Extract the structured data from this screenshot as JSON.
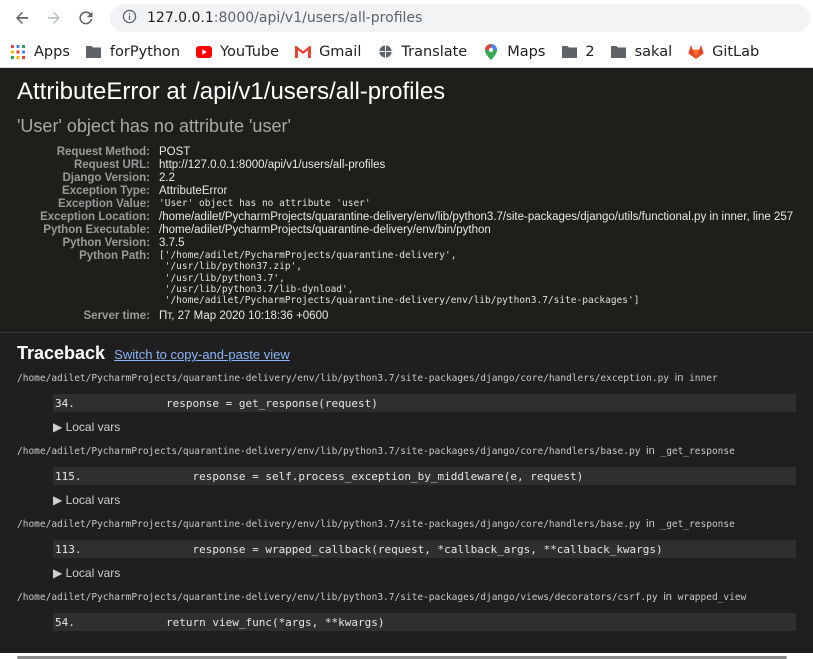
{
  "browser": {
    "url_host": "127.0.0.1",
    "url_path": ":8000/api/v1/users/all-profiles",
    "bookmarks": [
      {
        "label": "Apps",
        "icon": "apps-grid-icon"
      },
      {
        "label": "forPython",
        "icon": "folder-icon"
      },
      {
        "label": "YouTube",
        "icon": "youtube-icon"
      },
      {
        "label": "Gmail",
        "icon": "gmail-icon"
      },
      {
        "label": "Translate",
        "icon": "translate-icon"
      },
      {
        "label": "Maps",
        "icon": "maps-icon"
      },
      {
        "label": "2",
        "icon": "folder-icon"
      },
      {
        "label": "sakal",
        "icon": "folder-icon"
      },
      {
        "label": "GitLab",
        "icon": "gitlab-icon"
      }
    ]
  },
  "error": {
    "title": "AttributeError at /api/v1/users/all-profiles",
    "message": "'User' object has no attribute 'user'",
    "meta": [
      {
        "label": "Request Method:",
        "value": "POST",
        "mono": false
      },
      {
        "label": "Request URL:",
        "value": "http://127.0.0.1:8000/api/v1/users/all-profiles",
        "mono": false
      },
      {
        "label": "Django Version:",
        "value": "2.2",
        "mono": false
      },
      {
        "label": "Exception Type:",
        "value": "AttributeError",
        "mono": false
      },
      {
        "label": "Exception Value:",
        "value": "'User' object has no attribute 'user'",
        "mono": true
      },
      {
        "label": "Exception Location:",
        "value": "/home/adilet/PycharmProjects/quarantine-delivery/env/lib/python3.7/site-packages/django/utils/functional.py in inner, line 257",
        "mono": false
      },
      {
        "label": "Python Executable:",
        "value": "/home/adilet/PycharmProjects/quarantine-delivery/env/bin/python",
        "mono": false
      },
      {
        "label": "Python Version:",
        "value": "3.7.5",
        "mono": false
      }
    ],
    "python_path_label": "Python Path:",
    "python_path": [
      "['/home/adilet/PycharmProjects/quarantine-delivery',",
      " '/usr/lib/python37.zip',",
      " '/usr/lib/python3.7',",
      " '/usr/lib/python3.7/lib-dynload',",
      " '/home/adilet/PycharmProjects/quarantine-delivery/env/lib/python3.7/site-packages']"
    ],
    "server_time_label": "Server time:",
    "server_time": "Пт, 27 Мар 2020 10:18:36 +0600"
  },
  "traceback": {
    "title": "Traceback",
    "switch_link": "Switch to copy-and-paste view",
    "in_word": "in",
    "local_vars_label": "▶ Local vars",
    "frames": [
      {
        "file": "/home/adilet/PycharmProjects/quarantine-delivery/env/lib/python3.7/site-packages/django/core/handlers/exception.py",
        "func": "inner",
        "line": "34.",
        "code": "        response = get_response(request)"
      },
      {
        "file": "/home/adilet/PycharmProjects/quarantine-delivery/env/lib/python3.7/site-packages/django/core/handlers/base.py",
        "func": "_get_response",
        "line": "115.",
        "code": "            response = self.process_exception_by_middleware(e, request)"
      },
      {
        "file": "/home/adilet/PycharmProjects/quarantine-delivery/env/lib/python3.7/site-packages/django/core/handlers/base.py",
        "func": "_get_response",
        "line": "113.",
        "code": "            response = wrapped_callback(request, *callback_args, **callback_kwargs)"
      },
      {
        "file": "/home/adilet/PycharmProjects/quarantine-delivery/env/lib/python3.7/site-packages/django/views/decorators/csrf.py",
        "func": "wrapped_view",
        "line": "54.",
        "code": "        return view_func(*args, **kwargs)"
      }
    ]
  }
}
